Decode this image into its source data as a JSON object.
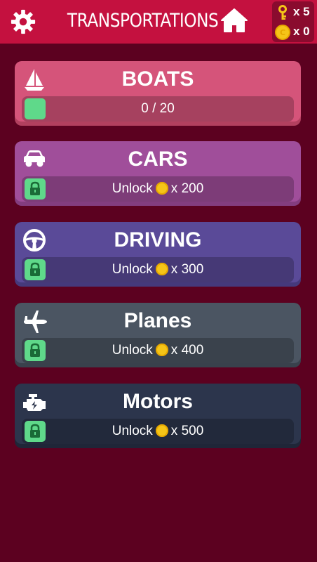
{
  "header": {
    "title": "TRANSPORTATIONS",
    "keys_count": "x 5",
    "coins_count": "x 0"
  },
  "categories": [
    {
      "name": "BOATS",
      "status": "0 / 20",
      "icon": "sailboat-icon",
      "color": "#d5547a",
      "base": "#b2405f"
    },
    {
      "name": "CARS",
      "unlock_text": "Unlock",
      "cost": "x 200",
      "icon": "car-icon",
      "color": "#a04e9a",
      "base": "#833d7f"
    },
    {
      "name": "DRIVING",
      "unlock_text": "Unlock",
      "cost": "x 300",
      "icon": "steering-wheel-icon",
      "color": "#5a4a98",
      "base": "#45397b"
    },
    {
      "name": "Planes",
      "unlock_text": "Unlock",
      "cost": "x 400",
      "icon": "airplane-icon",
      "color": "#4b5562",
      "base": "#39414c"
    },
    {
      "name": "Motors",
      "unlock_text": "Unlock",
      "cost": "x 500",
      "icon": "engine-icon",
      "color": "#2c354c",
      "base": "#1f2638"
    }
  ],
  "colors": {
    "background": "#5c0120",
    "topbar": "#c4113f",
    "lock_green": "#5fd98a",
    "coin_gold": "#f5c518"
  }
}
